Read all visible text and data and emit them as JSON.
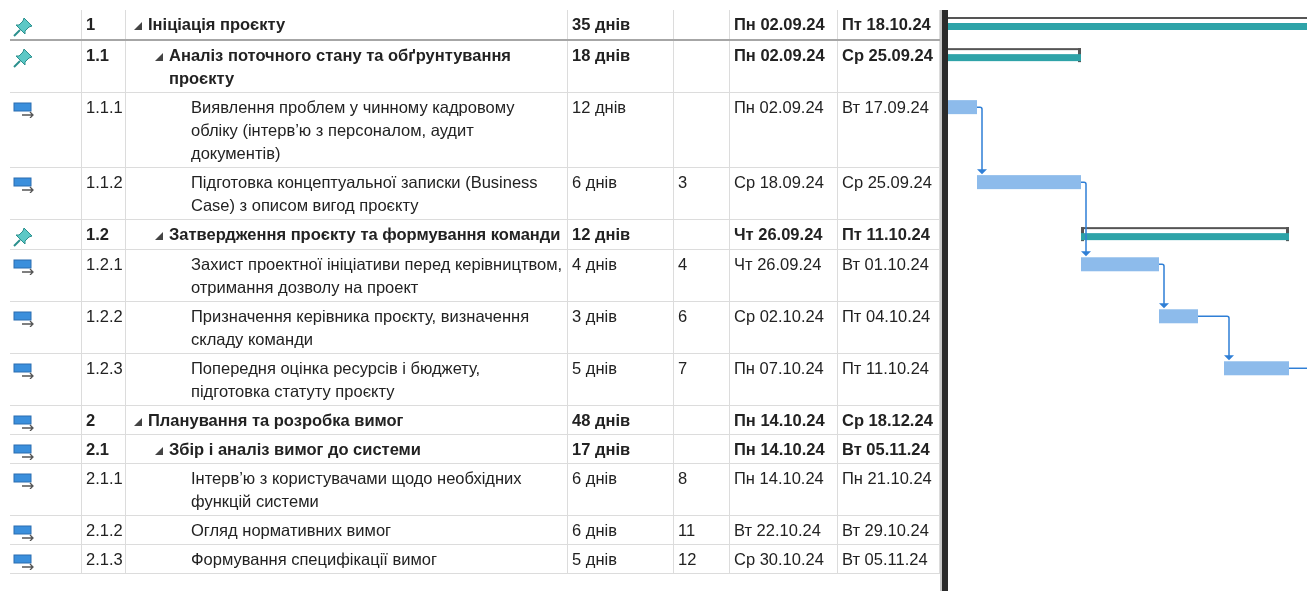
{
  "tasks": [
    {
      "kind": "manual",
      "wbs": "1",
      "name": "Ініціація проєкту",
      "duration": "35 днів",
      "start": "Пн 02.09.24",
      "finish": "Пт 18.10.24",
      "expanded": true,
      "children": [
        {
          "kind": "manual",
          "wbs": "1.1",
          "name": "Аналіз поточного стану та обґрунтування проєкту",
          "duration": "18 днів",
          "start": "Пн 02.09.24",
          "finish": "Ср 25.09.24",
          "expanded": true,
          "children": [
            {
              "kind": "auto",
              "wbs": "1.1.1",
              "name": "Виявлення проблем у чинному кадровому обліку (інтерв’ю з персоналом, аудит документів)",
              "duration": "12 днів",
              "start": "Пн 02.09.24",
              "finish": "Вт 17.09.24"
            },
            {
              "kind": "auto",
              "wbs": "1.1.2",
              "name": "Підготовка концептуальної записки (Business Case) з описом вигод проєкту",
              "duration": "6 днів",
              "predecessors": "3",
              "start": "Ср 18.09.24",
              "finish": "Ср 25.09.24"
            }
          ]
        },
        {
          "kind": "manual",
          "wbs": "1.2",
          "name": "Затвердження проєкту та формування команди",
          "duration": "12 днів",
          "start": "Чт 26.09.24",
          "finish": "Пт 11.10.24",
          "expanded": true,
          "children": [
            {
              "kind": "auto",
              "wbs": "1.2.1",
              "name": "Захист проектної ініціативи перед керівництвом, отримання дозволу на проект",
              "duration": "4 днів",
              "predecessors": "4",
              "start": "Чт 26.09.24",
              "finish": "Вт 01.10.24"
            },
            {
              "kind": "auto",
              "wbs": "1.2.2",
              "name": "Призначення керівника проєкту, визначення складу команди",
              "duration": "3 днів",
              "predecessors": "6",
              "start": "Ср 02.10.24",
              "finish": "Пт 04.10.24"
            },
            {
              "kind": "auto",
              "wbs": "1.2.3",
              "name": "Попередня оцінка ресурсів і бюджету, підготовка статуту проєкту",
              "duration": "5 днів",
              "predecessors": "7",
              "start": "Пн 07.10.24",
              "finish": "Пт 11.10.24"
            }
          ]
        }
      ]
    },
    {
      "kind": "auto",
      "wbs": "2",
      "name": "Планування та розробка вимог",
      "duration": "48 днів",
      "start": "Пн 14.10.24",
      "finish": "Ср 18.12.24",
      "expanded": true,
      "children": [
        {
          "kind": "auto",
          "wbs": "2.1",
          "name": "Збір і аналіз вимог до системи",
          "duration": "17 днів",
          "start": "Пн 14.10.24",
          "finish": "Вт 05.11.24",
          "expanded": true,
          "children": [
            {
              "kind": "auto",
              "wbs": "2.1.1",
              "name": "Інтерв’ю з користувачами щодо необхідних функцій системи",
              "duration": "6 днів",
              "predecessors": "8",
              "start": "Пн 14.10.24",
              "finish": "Пн 21.10.24"
            },
            {
              "kind": "auto",
              "wbs": "2.1.2",
              "name": "Огляд нормативних вимог",
              "duration": "6 днів",
              "predecessors": "11",
              "start": "Вт 22.10.24",
              "finish": "Вт 29.10.24"
            },
            {
              "kind": "auto",
              "wbs": "2.1.3",
              "name": "Формування специфікації вимог",
              "duration": "5 днів",
              "predecessors": "12",
              "start": "Ср 30.10.24",
              "finish": "Вт 05.11.24"
            }
          ]
        }
      ]
    }
  ]
}
